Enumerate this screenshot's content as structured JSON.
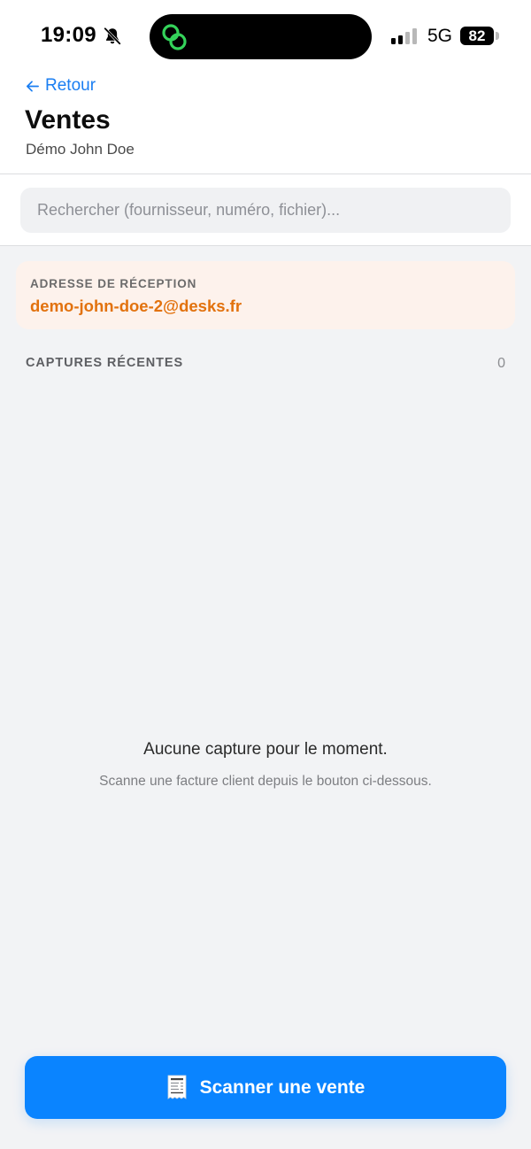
{
  "status_bar": {
    "time": "19:09",
    "network": "5G",
    "battery": "82",
    "icons": [
      "bell-slash-icon",
      "app-activity-icon",
      "signal-icon",
      "battery-icon"
    ]
  },
  "header": {
    "back_label": "Retour",
    "title": "Ventes",
    "subtitle": "Démo John Doe"
  },
  "search": {
    "placeholder": "Rechercher (fournisseur, numéro, fichier)...",
    "value": ""
  },
  "address": {
    "label": "ADRESSE DE RÉCEPTION",
    "value": "demo-john-doe-2@desks.fr"
  },
  "recent": {
    "label": "CAPTURES RÉCENTES",
    "count": "0"
  },
  "empty_state": {
    "title": "Aucune capture pour le moment.",
    "subtitle": "Scanne une facture client depuis le bouton ci-dessous."
  },
  "cta": {
    "label": "Scanner une vente",
    "icon": "receipt-icon"
  },
  "colors": {
    "accent": "#0a84ff",
    "link": "#1a7ef2",
    "address": "#e2720e",
    "address_bg": "#fdf2ec",
    "background": "#f2f3f5"
  }
}
